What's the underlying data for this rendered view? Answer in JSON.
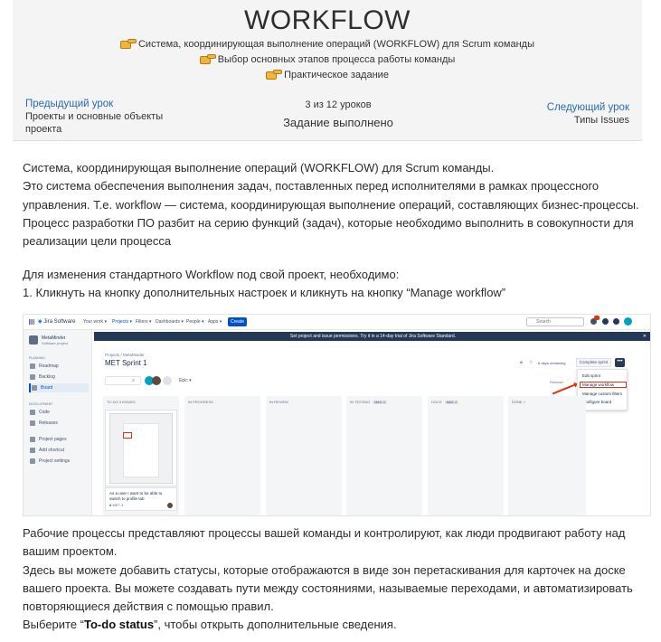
{
  "header": {
    "title": "WORKFLOW",
    "bullets": [
      "Система, координирующая выполнение операций (WORKFLOW) для Scrum команды",
      "Выбор основных этапов процесса работы команды",
      "Практическое задание"
    ]
  },
  "navigation": {
    "prev_label": "Предыдущий урок",
    "prev_title": "Проекты и основные объекты проекта",
    "progress": "3 из 12 уроков",
    "status": "Задание выполнено",
    "next_label": "Следующий урок",
    "next_title": "Типы Issues"
  },
  "content": {
    "paragraph1": [
      "Система, координирующая выполнение операций (WORKFLOW) для Scrum команды.",
      "Это система обеспечения выполнения задач, поставленных перед исполнителями в рамках процессного",
      "управления. Т.е. workflow — система, координирующая выполнение операций, составляющих бизнес-процессы.",
      "Процесс разработки ПО разбит на серию функций (задач), которые необходимо выполнить в совокупности для",
      "реализации цели процесса"
    ],
    "paragraph2": [
      "Для изменения стандартного Workflow под свой проект, необходимо:",
      "1. Кликнуть на кнопку дополнительных настроек и кликнуть на кнопку “Manage workflow”"
    ],
    "paragraph3": [
      "Рабочие процессы представляют процессы вашей команды и контролируют, как люди продвигают работу над",
      "вашим проектом.",
      "Здесь вы можете добавить статусы, которые отображаются в виде зон перетаскивания для карточек на доске",
      "вашего проекта. Вы можете создавать пути между состояниями, называемые переходами, и автоматизировать",
      "повторяющиеся действия с помощью правил."
    ],
    "last_line_prefix": "Выберите “",
    "last_line_bold": "To-do status",
    "last_line_suffix": "”, чтобы открыть дополнительные сведения."
  },
  "screenshot": {
    "app_name": "Jira Software",
    "nav": [
      "Your work ▾",
      "Projects ▾",
      "Filters ▾",
      "Dashboards ▾",
      "People ▾",
      "Apps ▾"
    ],
    "create": "Create",
    "search": "Search",
    "project_name": "MetaMinder",
    "project_type": "Software project",
    "planning_label": "PLANNING",
    "planning_items": [
      "Roadmap",
      "Backlog",
      "Board"
    ],
    "development_label": "DEVELOPMENT",
    "development_items": [
      "Code",
      "Releases"
    ],
    "other_items": [
      "Project pages",
      "Add shortcut",
      "Project settings"
    ],
    "banner": "Set project and issue permissions. Try it in a 14-day trial of Jira Software Standard.",
    "breadcrumb": "Projects / MetaMinder",
    "board_title": "MET Sprint 1",
    "days_left": "6 days remaining",
    "complete_sprint": "Complete sprint",
    "more_button": "•••",
    "epic_filter": "Epic ▾",
    "release": "Release",
    "menu": [
      "Edit sprint",
      "Manage workflow",
      "Manage custom filters",
      "Configure board"
    ],
    "columns": [
      {
        "name": "TO DO 3 ISSUES",
        "tag": ""
      },
      {
        "name": "IN PROGRESS",
        "tag": ""
      },
      {
        "name": "IN REVIEW",
        "tag": ""
      },
      {
        "name": "IN TESTING",
        "tag": "MAX: 2"
      },
      {
        "name": "DOCS",
        "tag": "MAX: 2"
      },
      {
        "name": "DONE ✓",
        "tag": ""
      }
    ],
    "card_text": "As a user I want to be able to switch to profile tab",
    "card_key": "MET-3"
  }
}
